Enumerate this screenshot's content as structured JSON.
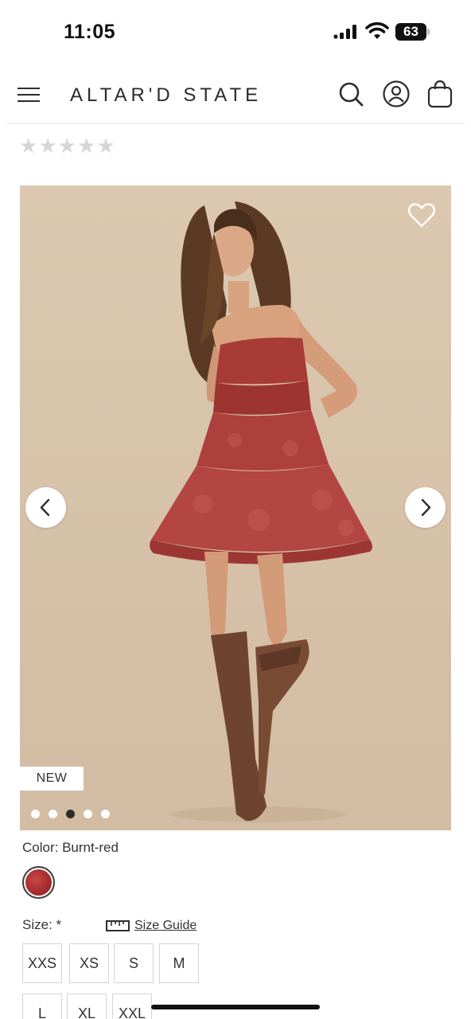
{
  "status_bar": {
    "time": "11:05",
    "battery_percent": "63"
  },
  "header": {
    "brand": "ALTAR'D STATE",
    "menu_icon": "hamburger-icon",
    "search_icon": "search-icon",
    "account_icon": "user-icon",
    "cart_icon": "shopping-bag-icon"
  },
  "rating": {
    "stars_filled": 0,
    "stars_total": 5
  },
  "gallery": {
    "badge": "NEW",
    "image_count": 5,
    "active_index": 2,
    "favorite_icon": "heart-icon",
    "prev_icon": "chevron-left-icon",
    "next_icon": "chevron-right-icon"
  },
  "product": {
    "color_label": "Color: Burnt-red",
    "swatch_color": "#a8302f",
    "size_label": "Size: *",
    "size_guide": "Size Guide",
    "sizes": [
      "XXS",
      "XS",
      "S",
      "M",
      "L",
      "XL",
      "XXL"
    ]
  }
}
